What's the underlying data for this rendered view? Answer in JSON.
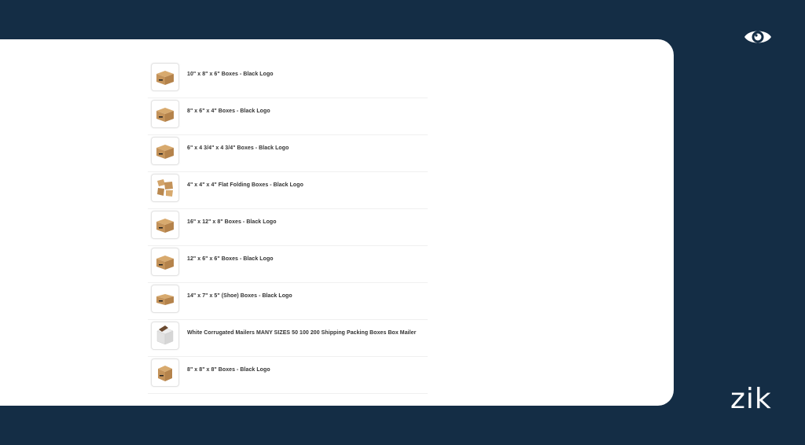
{
  "products": [
    {
      "title": "10\" x 8\" x 6\" Boxes - Black Logo",
      "image": "box-icon"
    },
    {
      "title": "8\" x 6\" x 4\" Boxes - Black Logo",
      "image": "box-icon"
    },
    {
      "title": "6\" x 4 3/4\" x 4 3/4\" Boxes - Black Logo",
      "image": "box-icon"
    },
    {
      "title": "4\" x 4\" x 4\" Flat Folding Boxes - Black Logo",
      "image": "folding-box-icon"
    },
    {
      "title": "16\" x 12\" x 8\" Boxes - Black Logo",
      "image": "box-icon"
    },
    {
      "title": "12\" x 6\" x 6\" Boxes - Black Logo",
      "image": "box-icon"
    },
    {
      "title": "14\" x 7\" x 5\" (Shoe) Boxes - Black Logo",
      "image": "box-icon"
    },
    {
      "title": "White Corrugated Mailers MANY SIZES 50 100 200 Shipping Packing Boxes Box Mailer",
      "image": "white-mailer-icon"
    },
    {
      "title": "8\" x 8\" x 8\" Boxes - Black Logo",
      "image": "box-icon"
    }
  ],
  "brand": {
    "logo_text": "zik"
  },
  "icons": {
    "top_right": "eye-icon"
  },
  "colors": {
    "background": "#142d45",
    "card": "#ffffff",
    "box_brown": "#c99a5f",
    "text": "#333333"
  }
}
